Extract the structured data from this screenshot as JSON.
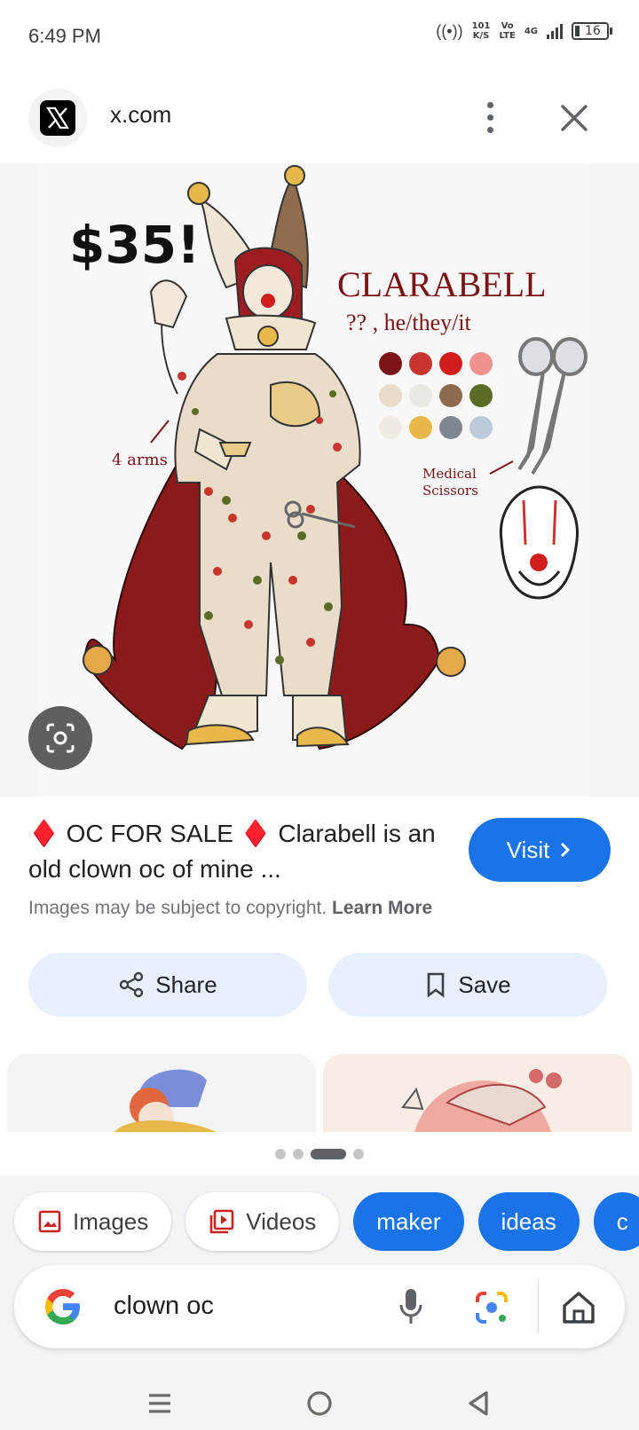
{
  "status_bar": {
    "time": "6:49 PM",
    "net_speed_value": "101",
    "net_speed_unit": "K/S",
    "volte_top": "Vo",
    "volte_bottom": "LTE",
    "network_type": "4G",
    "battery_level": "16"
  },
  "header": {
    "site_name": "x.com",
    "favicon_icon": "x-logo-icon"
  },
  "image": {
    "price_text": "$35!",
    "character_name": "CLARABELL",
    "pronouns": "?? , he/they/it",
    "arms_note": "4 arms",
    "scissors_note_line1": "Medical",
    "scissors_note_line2": "Scissors",
    "palette": [
      "#7a1416",
      "#c8352e",
      "#d21d1d",
      "#f0938c",
      "#e9ddc9",
      "#ebe8e3",
      "#8d6a4c",
      "#5a6b26",
      "#f1ece2",
      "#e9b84a",
      "#7c8791",
      "#bccbdc"
    ]
  },
  "result": {
    "title": "♦️ OC FOR SALE ♦️ Clarabell is an old clown oc of mine ...",
    "visit_label": "Visit",
    "copyright_text": "Images may be subject to copyright.",
    "learn_more_label": "Learn More",
    "share_label": "Share",
    "save_label": "Save"
  },
  "chips": [
    {
      "label": "Images",
      "icon": "image-icon"
    },
    {
      "label": "Videos",
      "icon": "video-icon"
    },
    {
      "label": "maker"
    },
    {
      "label": "ideas"
    },
    {
      "label": "c"
    }
  ],
  "search": {
    "query": "clown oc"
  },
  "colors": {
    "accent_blue": "#1a73e8",
    "pill_background": "#e8f0fe",
    "cape_red": "#8b1a1a"
  }
}
